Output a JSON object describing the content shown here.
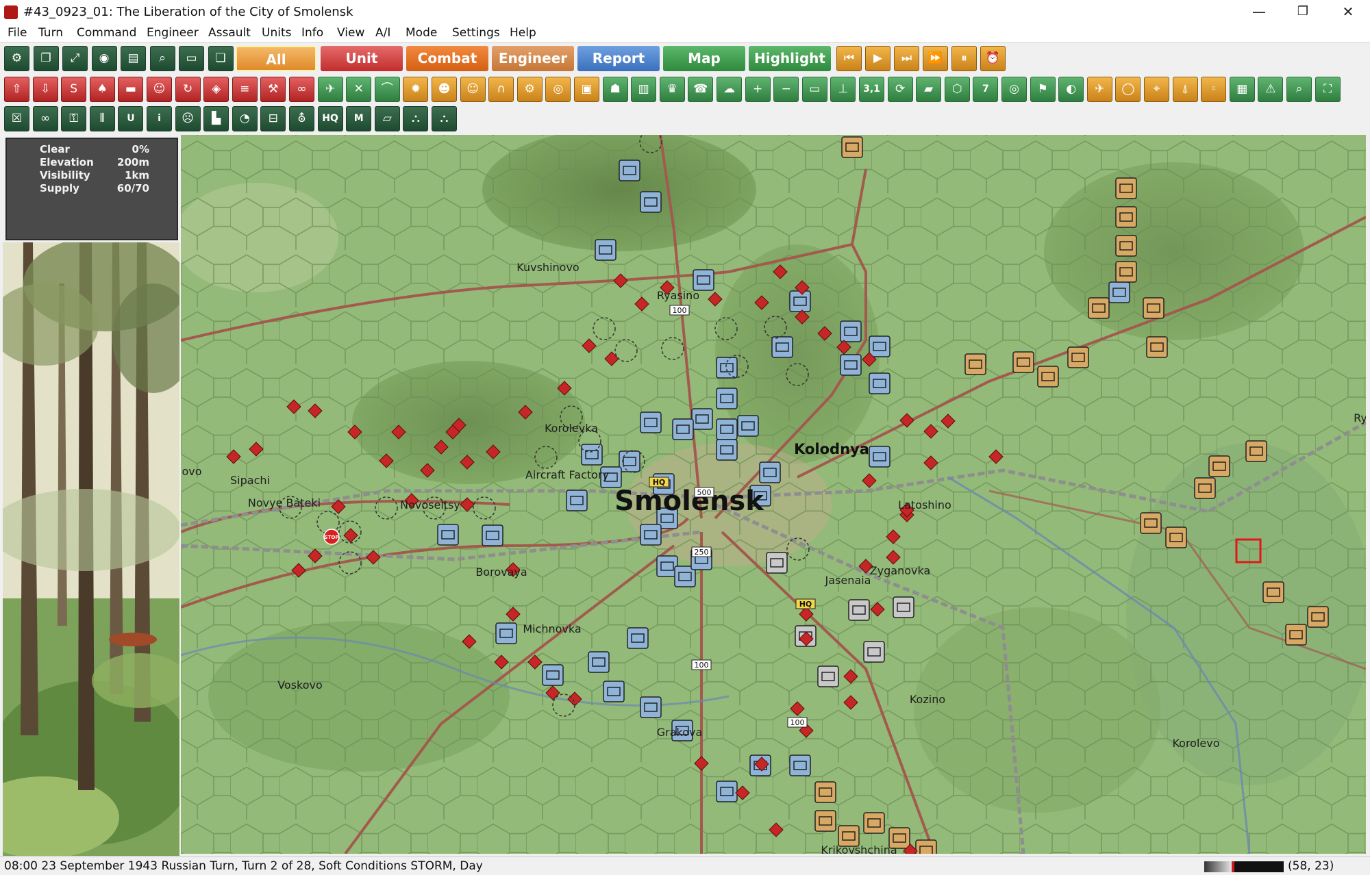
{
  "window": {
    "title": "#43_0923_01: The Liberation of the City of Smolensk",
    "controls": [
      "—",
      "❐",
      "✕"
    ]
  },
  "menu": [
    "File",
    "Turn",
    "Command",
    "Engineer",
    "Assault",
    "Units",
    "Info",
    "View",
    "A/I",
    "Mode",
    "Settings",
    "Help"
  ],
  "filter_tabs": [
    {
      "label": "All",
      "color": "#e89b3c",
      "selected": true
    },
    {
      "label": "Unit",
      "color": "#d23b3b"
    },
    {
      "label": "Combat",
      "color": "#e2701f"
    },
    {
      "label": "Engineer",
      "color": "#d28a4a"
    },
    {
      "label": "Report",
      "color": "#4f86cc"
    },
    {
      "label": "Map",
      "color": "#3e9a4a"
    },
    {
      "label": "Highlight",
      "color": "#3e9a4a"
    }
  ],
  "toolbar_row1_icons": [
    "settings-icon",
    "window-icon",
    "resize-icon",
    "eye-icon",
    "map-book-icon",
    "search-icon",
    "document-icon",
    "scroll-icon"
  ],
  "playback_icons": [
    "rewind-icon",
    "play-icon",
    "fast-forward-icon",
    "skip-end-icon",
    "pause-icon",
    "alarm-icon"
  ],
  "toolbar_row2_icons": [
    "upload-icon",
    "download-icon",
    "supply-icon",
    "unit-icon",
    "tank-icon",
    "infantry-icon",
    "rotate-icon",
    "shield-icon",
    "list-icon",
    "shovel-icon",
    "binoculars-icon",
    "plane-icon",
    "crossed-swords-icon",
    "bridge-icon",
    "mine-icon",
    "soldier-icon",
    "face-icon",
    "tunnel-icon",
    "gear-icon",
    "disc-icon",
    "crate-icon",
    "people-icon",
    "book-icon",
    "trophy-icon",
    "phone-icon",
    "cloud-icon",
    "plus-icon",
    "minus-icon",
    "monitor-icon",
    "signpost-icon",
    "label-icon",
    "cycle-icon",
    "terrain-icon",
    "hex-icon",
    "number-icon",
    "target-icon",
    "flag-icon",
    "contrast-icon",
    "aircraft-icon",
    "coin-icon",
    "crosshair-icon",
    "antenna-icon",
    "dot-icon",
    "layers-icon",
    "warning-icon",
    "zoom-icon",
    "fullscreen-icon"
  ],
  "toolbar_row2_labels": {
    "label-icon": "3,1",
    "number-icon": "7"
  },
  "toolbar_row3_icons": [
    "close-box-icon",
    "chain-icon",
    "lock-icon",
    "bars-icon",
    "u-icon",
    "info-icon",
    "mood-icon",
    "boot-icon",
    "pie-icon",
    "minus-box-icon",
    "unit-type-icon",
    "hq-icon",
    "m-icon",
    "slash-box-icon",
    "hierarchy-icon",
    "hierarchy2-icon"
  ],
  "toolbar_row3_labels": {
    "u-icon": "U",
    "info-icon": "i",
    "hq-icon": "HQ",
    "m-icon": "M"
  },
  "hex_info": [
    {
      "label": "Clear",
      "value": "0%"
    },
    {
      "label": "Elevation",
      "value": "200m"
    },
    {
      "label": "Visibility",
      "value": "1km"
    },
    {
      "label": "Supply",
      "value": "60/70"
    }
  ],
  "map": {
    "towns": [
      {
        "name": "Kuvshinovo"
      },
      {
        "name": "Ryasino"
      },
      {
        "name": "Korolevka"
      },
      {
        "name": "Kolodnya"
      },
      {
        "name": "Smolensk"
      },
      {
        "name": "Aircraft Factory"
      },
      {
        "name": "Sipachi"
      },
      {
        "name": "Novye Bateki"
      },
      {
        "name": "Novoseltsy"
      },
      {
        "name": "Latoshino"
      },
      {
        "name": "Borovaya"
      },
      {
        "name": "Zyganovka"
      },
      {
        "name": "Jasenaia"
      },
      {
        "name": "Michnovka"
      },
      {
        "name": "Voskovo"
      },
      {
        "name": "Kozino"
      },
      {
        "name": "Grakova"
      },
      {
        "name": "Korolevo"
      },
      {
        "name": "Krikovshchina"
      },
      {
        "name": "ovo"
      },
      {
        "name": "Ry"
      }
    ],
    "strength_labels": [
      "100",
      "500",
      "250",
      "100",
      "100"
    ],
    "hq_label": "HQ",
    "stop_label": "STOP"
  },
  "status": {
    "text": "08:00 23 September 1943 Russian Turn, Turn 2 of 28, Soft Conditions STORM, Day",
    "coordinates": "(58, 23)",
    "turn_progress": 0.36
  }
}
